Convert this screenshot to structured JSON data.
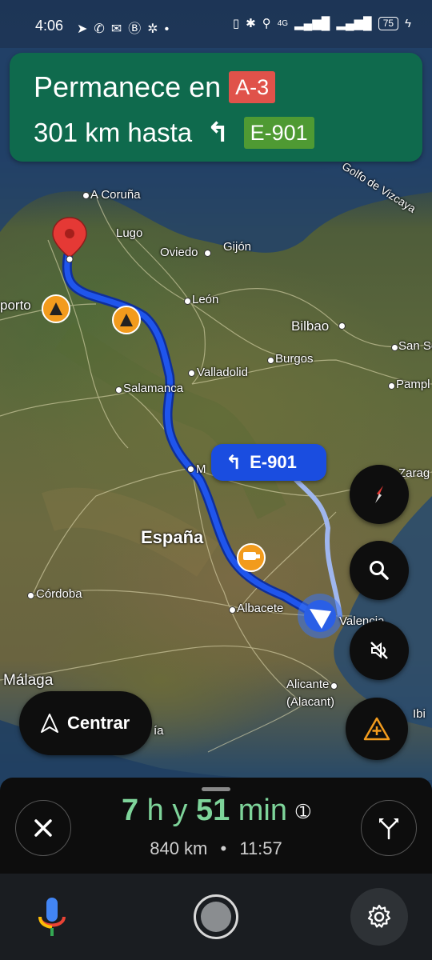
{
  "status_bar": {
    "time": "4:06",
    "left_icons": [
      "navigation-icon",
      "whatsapp-icon",
      "chat-icon",
      "b-icon",
      "sparkle-icon",
      "dot-icon"
    ],
    "battery": "75",
    "network": "4G"
  },
  "instruction": {
    "line1_text": "Permanece en",
    "road_shield": "A-3",
    "line2_text": "301 km hasta",
    "next_shield": "E-901"
  },
  "map": {
    "sea_label": "Golfo de Vizcaya",
    "cities": [
      {
        "name": "A Coruña"
      },
      {
        "name": "Lugo"
      },
      {
        "name": "Oviedo"
      },
      {
        "name": "Gijón"
      },
      {
        "name": "León"
      },
      {
        "name": "Bilbao"
      },
      {
        "name": "San Se"
      },
      {
        "name": "Burgos"
      },
      {
        "name": "Pampl"
      },
      {
        "name": "Valladolid"
      },
      {
        "name": "Salamanca"
      },
      {
        "name": "Zarag"
      },
      {
        "name": "M"
      },
      {
        "name": "España"
      },
      {
        "name": "Córdoba"
      },
      {
        "name": "Albacete"
      },
      {
        "name": "Valencia"
      },
      {
        "name": "Málaga"
      },
      {
        "name": "Alicante"
      },
      {
        "name": "(Alacant)"
      },
      {
        "name": "Ibi"
      },
      {
        "name": "porto"
      },
      {
        "name": "ía"
      }
    ],
    "route_callout": "E-901"
  },
  "controls": {
    "centrar_label": "Centrar"
  },
  "eta": {
    "hours": "7",
    "h_unit": "h y",
    "minutes": "51",
    "min_unit": "min",
    "distance": "840 km",
    "separator": "•",
    "arrival": "11:57"
  },
  "colors": {
    "instruction_bg": "#0f6a4d",
    "route": "#1a4de0",
    "eta_green": "#7ed49a",
    "shield_red": "#e0524a",
    "shield_green": "#4f9a33"
  }
}
